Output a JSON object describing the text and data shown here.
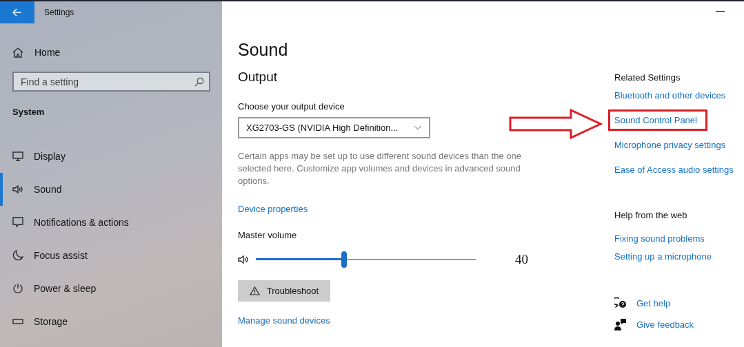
{
  "window": {
    "title": "Settings",
    "minimize": "—"
  },
  "sidebar": {
    "home": "Home",
    "search": {
      "placeholder": "Find a setting"
    },
    "section": "System",
    "items": [
      {
        "label": "Display",
        "selected": false
      },
      {
        "label": "Sound",
        "selected": true
      },
      {
        "label": "Notifications & actions",
        "selected": false
      },
      {
        "label": "Focus assist",
        "selected": false
      },
      {
        "label": "Power & sleep",
        "selected": false
      },
      {
        "label": "Storage",
        "selected": false
      }
    ]
  },
  "page": {
    "title": "Sound",
    "output": {
      "heading": "Output",
      "device_label": "Choose your output device",
      "device_value": "XG2703-GS (NVIDIA High Definition...",
      "description": "Certain apps may be set up to use different sound devices than the one selected here. Customize app volumes and devices in advanced sound options.",
      "device_properties": "Device properties",
      "master_volume": {
        "label": "Master volume",
        "level": 0.4,
        "reading": "40"
      },
      "troubleshoot": "Troubleshoot",
      "manage": "Manage sound devices"
    }
  },
  "related": {
    "heading": "Related Settings",
    "links": [
      {
        "label": "Bluetooth and other devices",
        "highlighted": false
      },
      {
        "label": "Sound Control Panel",
        "highlighted": true
      },
      {
        "label": "Microphone privacy settings",
        "highlighted": false
      },
      {
        "label": "Ease of Access audio settings",
        "highlighted": false
      }
    ]
  },
  "help": {
    "heading": "Help from the web",
    "links": [
      "Fixing sound problems",
      "Setting up a microphone"
    ]
  },
  "support": [
    {
      "label": "Get help"
    },
    {
      "label": "Give feedback"
    }
  ]
}
